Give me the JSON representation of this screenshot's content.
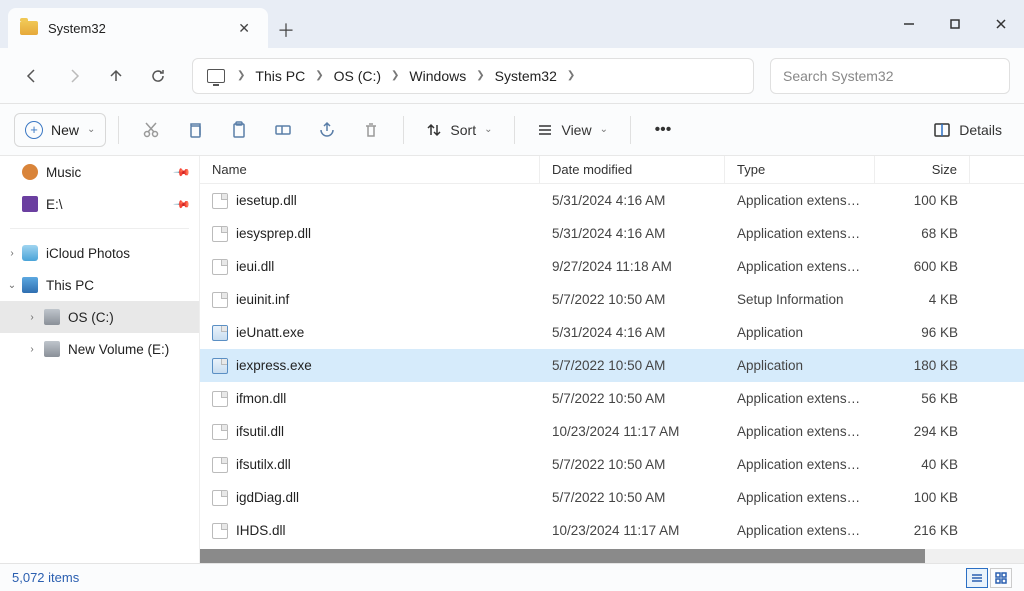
{
  "window": {
    "title": "System32"
  },
  "breadcrumb": {
    "root_icon": "monitor-icon",
    "segments": [
      "This PC",
      "OS (C:)",
      "Windows",
      "System32"
    ]
  },
  "search": {
    "placeholder": "Search System32"
  },
  "toolbar": {
    "new_label": "New",
    "sort_label": "Sort",
    "view_label": "View",
    "details_label": "Details"
  },
  "sidebar": {
    "top": [
      {
        "icon": "music-icon",
        "label": "Music",
        "pinned": true
      },
      {
        "icon": "video-icon",
        "label": "E:\\",
        "pinned": true
      }
    ],
    "bottom": [
      {
        "chev": ">",
        "icon": "cloud-icon",
        "label": "iCloud Photos",
        "indent": 0,
        "selected": false
      },
      {
        "chev": "v",
        "icon": "pc-icon",
        "label": "This PC",
        "indent": 0,
        "selected": false
      },
      {
        "chev": ">",
        "icon": "drive-icon",
        "label": "OS (C:)",
        "indent": 1,
        "selected": true
      },
      {
        "chev": ">",
        "icon": "drive-icon",
        "label": "New Volume (E:)",
        "indent": 1,
        "selected": false
      }
    ]
  },
  "columns": {
    "name": "Name",
    "date": "Date modified",
    "type": "Type",
    "size": "Size",
    "sorted": "name"
  },
  "files": [
    {
      "name": "iesetup.dll",
      "date": "5/31/2024 4:16 AM",
      "type": "Application extension",
      "size": "100 KB",
      "icon": "dll",
      "selected": false
    },
    {
      "name": "iesysprep.dll",
      "date": "5/31/2024 4:16 AM",
      "type": "Application extension",
      "size": "68 KB",
      "icon": "dll",
      "selected": false
    },
    {
      "name": "ieui.dll",
      "date": "9/27/2024 11:18 AM",
      "type": "Application extension",
      "size": "600 KB",
      "icon": "dll",
      "selected": false
    },
    {
      "name": "ieuinit.inf",
      "date": "5/7/2022 10:50 AM",
      "type": "Setup Information",
      "size": "4 KB",
      "icon": "inf",
      "selected": false
    },
    {
      "name": "ieUnatt.exe",
      "date": "5/31/2024 4:16 AM",
      "type": "Application",
      "size": "96 KB",
      "icon": "exe",
      "selected": false
    },
    {
      "name": "iexpress.exe",
      "date": "5/7/2022 10:50 AM",
      "type": "Application",
      "size": "180 KB",
      "icon": "exe",
      "selected": true
    },
    {
      "name": "ifmon.dll",
      "date": "5/7/2022 10:50 AM",
      "type": "Application extension",
      "size": "56 KB",
      "icon": "dll",
      "selected": false
    },
    {
      "name": "ifsutil.dll",
      "date": "10/23/2024 11:17 AM",
      "type": "Application extension",
      "size": "294 KB",
      "icon": "dll",
      "selected": false
    },
    {
      "name": "ifsutilx.dll",
      "date": "5/7/2022 10:50 AM",
      "type": "Application extension",
      "size": "40 KB",
      "icon": "dll",
      "selected": false
    },
    {
      "name": "igdDiag.dll",
      "date": "5/7/2022 10:50 AM",
      "type": "Application extension",
      "size": "100 KB",
      "icon": "dll",
      "selected": false
    },
    {
      "name": "IHDS.dll",
      "date": "10/23/2024 11:17 AM",
      "type": "Application extension",
      "size": "216 KB",
      "icon": "dll",
      "selected": false
    }
  ],
  "status": {
    "items": "5,072 items"
  }
}
